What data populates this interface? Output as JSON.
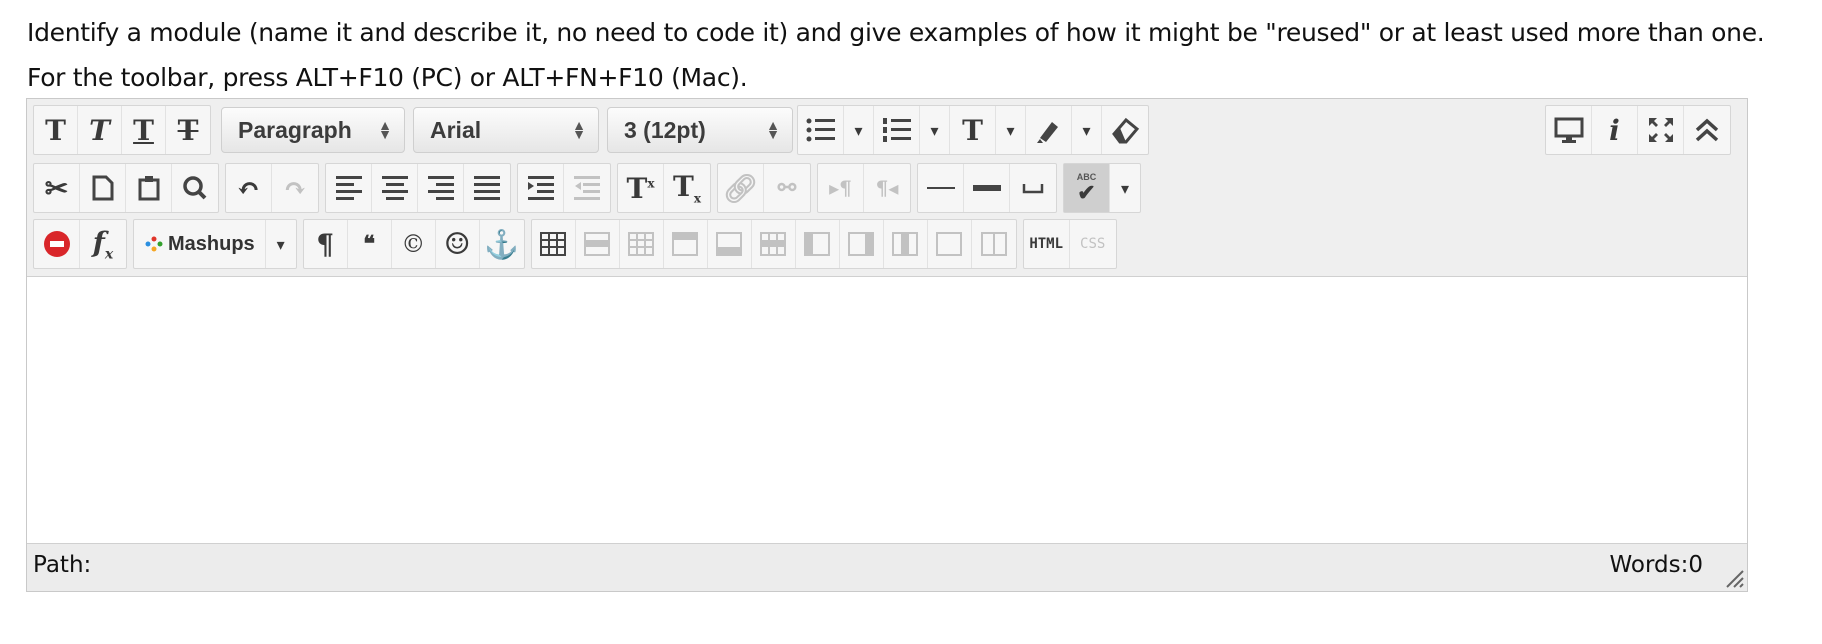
{
  "question": {
    "text": "Identify a module (name it and describe it, no need to code it) and give examples of how it might be \"reused\" or at least used more than one.",
    "hint": "For the toolbar, press ALT+F10 (PC) or ALT+FN+F10 (Mac)."
  },
  "toolbar": {
    "row1": {
      "format_buttons": [
        {
          "glyph": "T",
          "icon": "bold-icon"
        },
        {
          "glyph": "T",
          "icon": "italic-icon"
        },
        {
          "glyph": "T",
          "icon": "underline-icon"
        },
        {
          "glyph": "T",
          "icon": "strikethrough-icon"
        }
      ],
      "block_format": "Paragraph",
      "font_family": "Arial",
      "font_size": "3 (12pt)",
      "text_color_glyph": "T"
    },
    "row2": {
      "superscript_glyph": "T",
      "superscript_mark": "x",
      "subscript_glyph": "T",
      "subscript_mark": "x",
      "spellcheck_label": "ABC"
    },
    "row3": {
      "formula_glyph": "f",
      "formula_sub": "x",
      "mashups_label": "Mashups",
      "pilcrow_glyph": "¶",
      "quote_glyph": "❝",
      "copyright_glyph": "©",
      "emoji_glyph": "☺",
      "anchor_glyph": "⚓",
      "html_label": "HTML",
      "css_label": "CSS"
    }
  },
  "statusbar": {
    "path_label": "Path:",
    "words_label": "Words:0"
  }
}
